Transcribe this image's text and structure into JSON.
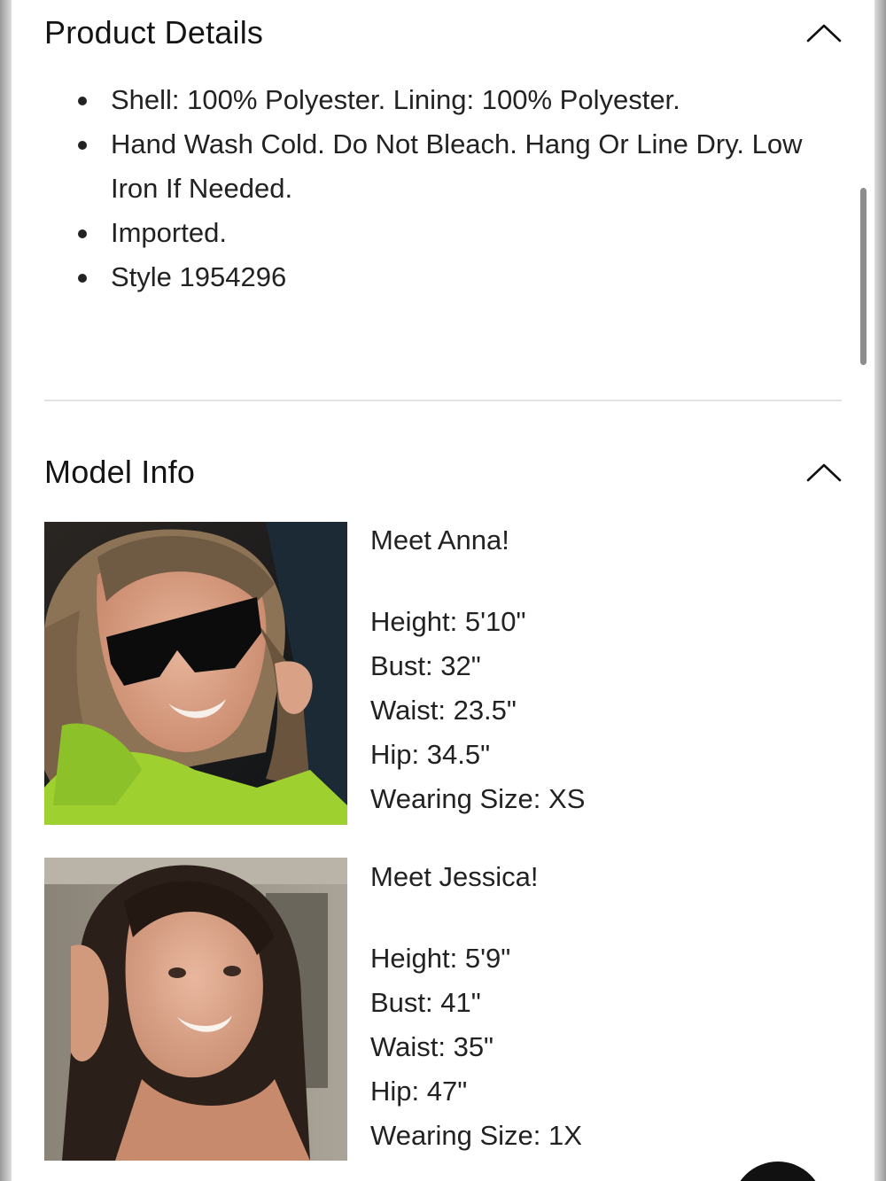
{
  "product_details": {
    "title": "Product Details",
    "toggle_icon": "chevron-up-icon",
    "items": [
      "Shell: 100% Polyester. Lining: 100% Polyester.",
      "Hand Wash Cold. Do Not Bleach. Hang Or Line Dry. Low Iron If Needed.",
      "Imported.",
      "Style 1954296"
    ]
  },
  "model_info": {
    "title": "Model Info",
    "toggle_icon": "chevron-up-icon",
    "models": [
      {
        "greeting": "Meet Anna!",
        "height": "Height: 5'10\"",
        "bust": "Bust: 32\"",
        "waist": "Waist: 23.5\"",
        "hip": "Hip: 34.5\"",
        "size": "Wearing Size: XS"
      },
      {
        "greeting": "Meet Jessica!",
        "height": "Height: 5'9\"",
        "bust": "Bust: 41\"",
        "waist": "Waist: 35\"",
        "hip": "Hip: 47\"",
        "size": "Wearing Size: 1X"
      }
    ]
  },
  "colors": {
    "text": "#1a1a1a",
    "divider": "#e3e3e3",
    "fab": "#111111"
  }
}
